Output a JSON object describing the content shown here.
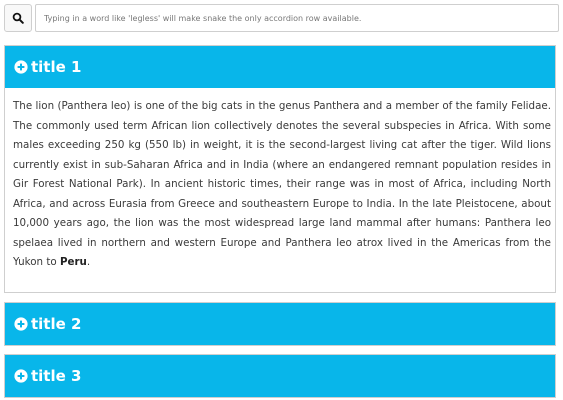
{
  "search": {
    "placeholder": "Typing in a word like 'legless' will make snake the only accordion row available.",
    "value": ""
  },
  "accordion": {
    "items": [
      {
        "title": "title 1",
        "expanded": true,
        "body_text": "The lion (Panthera leo) is one of the big cats in the genus Panthera and a member of the family Felidae. The commonly used term African lion collectively denotes the several subspecies in Africa. With some males exceeding 250 kg (550 lb) in weight, it is the second-largest living cat after the tiger. Wild lions currently exist in sub-Saharan Africa and in India (where an endangered remnant population resides in Gir Forest National Park). In ancient historic times, their range was in most of Africa, including North Africa, and across Eurasia from Greece and southeastern Europe to India. In the late Pleistocene, about 10,000 years ago, the lion was the most widespread large land mammal after humans: Panthera leo spelaea lived in northern and western Europe and Panthera leo atrox lived in the Americas from the Yukon to ",
        "body_bold": "Peru",
        "body_end": "."
      },
      {
        "title": "title 2",
        "expanded": false
      },
      {
        "title": "title 3",
        "expanded": false
      }
    ]
  },
  "colors": {
    "header_bg": "#08b6ea",
    "header_text": "#ffffff"
  },
  "icons": {
    "search": "search-icon",
    "expand": "plus-circle-icon"
  }
}
